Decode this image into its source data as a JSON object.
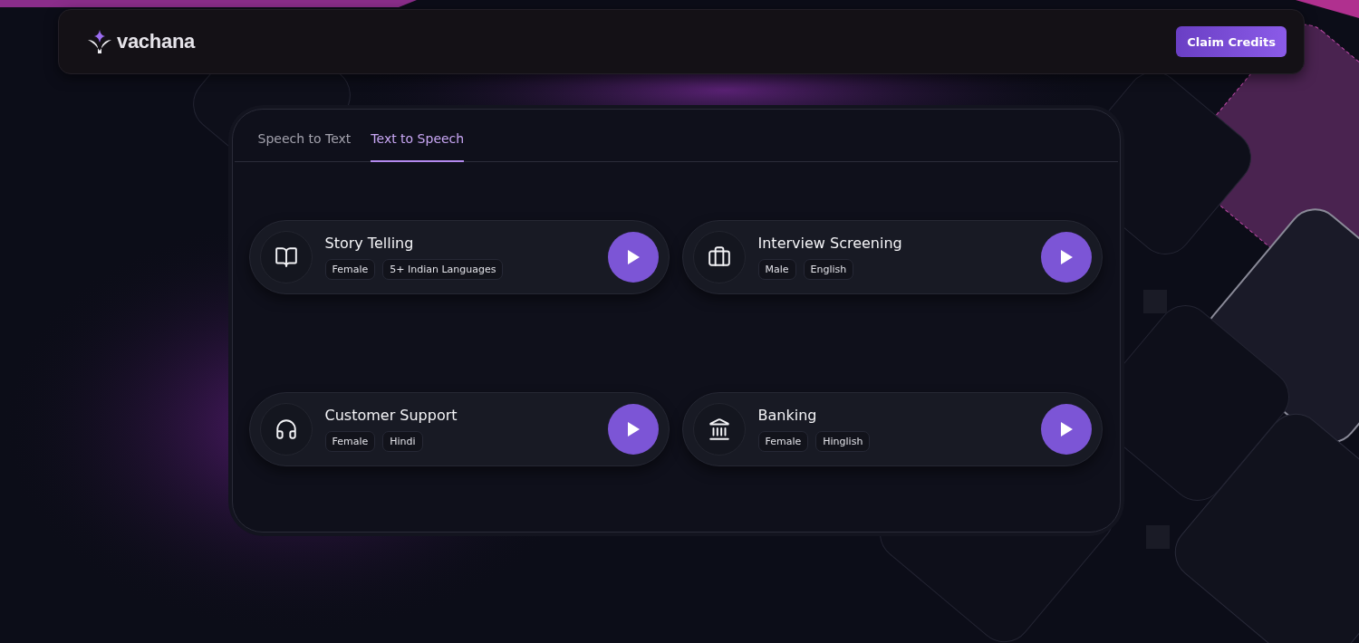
{
  "brand": {
    "name": "vachana"
  },
  "header": {
    "button": "Claim Credits"
  },
  "tabs": [
    {
      "label": "Speech to Text",
      "selected": false
    },
    {
      "label": "Text to Speech",
      "selected": true
    }
  ],
  "voices": [
    {
      "title": "Story Telling",
      "tags": [
        "Female",
        "5+ Indian Languages"
      ]
    },
    {
      "title": "Interview Screening",
      "tags": [
        "Male",
        "English"
      ]
    },
    {
      "title": "Customer Support",
      "tags": [
        "Female",
        "Hindi"
      ]
    },
    {
      "title": "Banking",
      "tags": [
        "Female",
        "Hinglish"
      ]
    }
  ]
}
